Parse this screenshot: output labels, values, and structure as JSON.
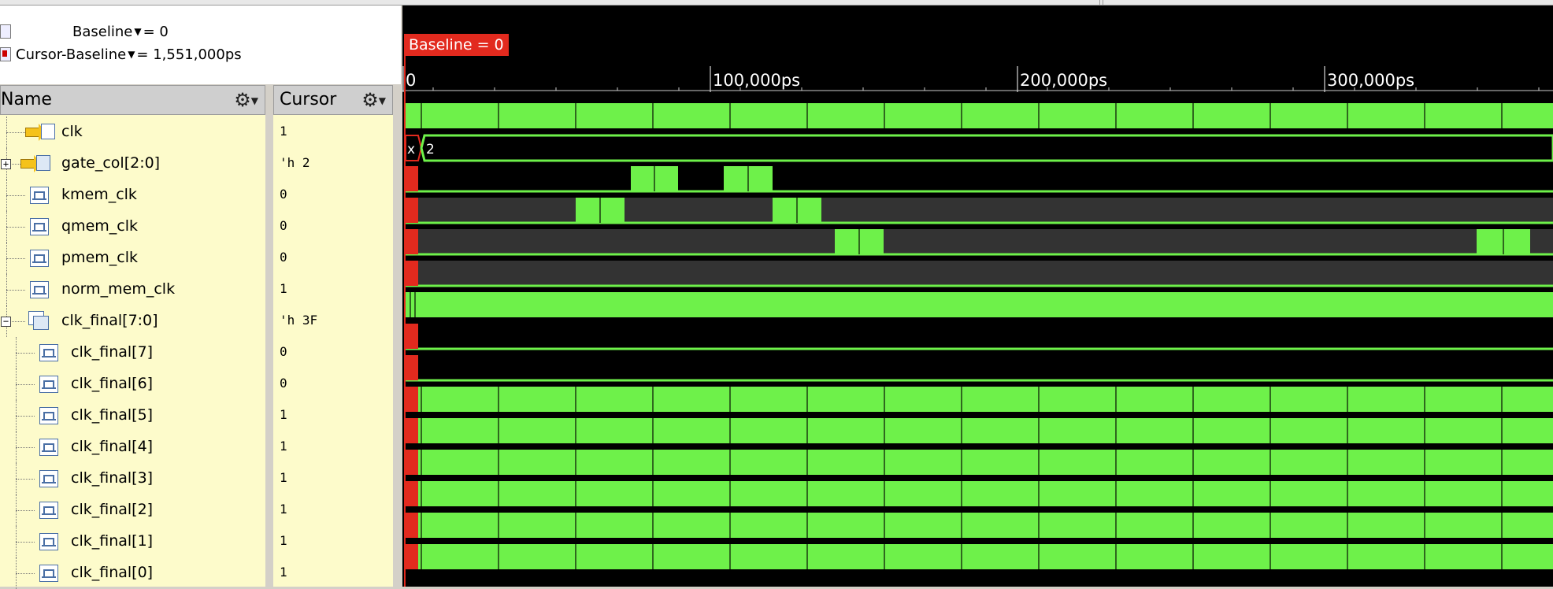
{
  "header": {
    "baseline_label": "Baseline",
    "baseline_value": "= 0",
    "cursor_baseline_label": "Cursor-Baseline",
    "cursor_baseline_value": "= 1,551,000ps",
    "dropdown_glyph": "▼"
  },
  "columns": {
    "name_header": "Name",
    "cursor_header": "Cursor",
    "gear_glyph": "⚙",
    "gear_dropdown": "▼"
  },
  "waveform": {
    "baseline_marker": "Baseline = 0",
    "ruler": [
      "0",
      "100,000ps",
      "200,000ps",
      "300,000ps"
    ],
    "bus_labels": {
      "gate_col_x": "x",
      "gate_col_value": "2"
    },
    "colors": {
      "signal": "#6ef14a",
      "background": "#000000",
      "baseline": "#e22a1e",
      "bus_fill": "#6ef14a"
    }
  },
  "signals": [
    {
      "name": "clk",
      "value": "1",
      "icon": "input-arrow-icon",
      "level": 1
    },
    {
      "name": "gate_col[2:0]",
      "value": "'h 2",
      "icon": "bus-input-icon",
      "level": 1,
      "expander": "+"
    },
    {
      "name": "kmem_clk",
      "value": "0",
      "icon": "signal-icon",
      "level": 1
    },
    {
      "name": "qmem_clk",
      "value": "0",
      "icon": "signal-icon",
      "level": 1
    },
    {
      "name": "pmem_clk",
      "value": "0",
      "icon": "signal-icon",
      "level": 1
    },
    {
      "name": "norm_mem_clk",
      "value": "1",
      "icon": "signal-icon",
      "level": 1
    },
    {
      "name": "clk_final[7:0]",
      "value": "'h 3F",
      "icon": "bus-icon",
      "level": 1,
      "expander": "−"
    },
    {
      "name": "clk_final[7]",
      "value": "0",
      "icon": "signal-icon",
      "level": 2
    },
    {
      "name": "clk_final[6]",
      "value": "0",
      "icon": "signal-icon",
      "level": 2
    },
    {
      "name": "clk_final[5]",
      "value": "1",
      "icon": "signal-icon",
      "level": 2
    },
    {
      "name": "clk_final[4]",
      "value": "1",
      "icon": "signal-icon",
      "level": 2
    },
    {
      "name": "clk_final[3]",
      "value": "1",
      "icon": "signal-icon",
      "level": 2
    },
    {
      "name": "clk_final[2]",
      "value": "1",
      "icon": "signal-icon",
      "level": 2
    },
    {
      "name": "clk_final[1]",
      "value": "1",
      "icon": "signal-icon",
      "level": 2
    },
    {
      "name": "clk_final[0]",
      "value": "1",
      "icon": "signal-icon",
      "level": 2
    }
  ]
}
